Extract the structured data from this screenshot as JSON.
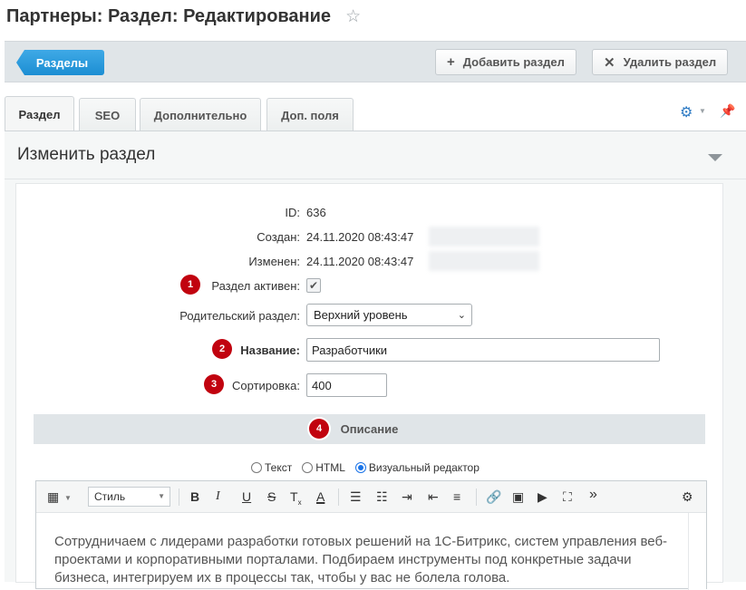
{
  "page": {
    "title": "Партнеры: Раздел: Редактирование"
  },
  "toolbar": {
    "back_label": "Разделы",
    "add_label": "Добавить раздел",
    "delete_label": "Удалить раздел"
  },
  "tabs": [
    {
      "label": "Раздел",
      "active": true
    },
    {
      "label": "SEO",
      "active": false
    },
    {
      "label": "Дополнительно",
      "active": false
    },
    {
      "label": "Доп. поля",
      "active": false
    }
  ],
  "panel": {
    "title": "Изменить раздел"
  },
  "form": {
    "id_label": "ID:",
    "id_value": "636",
    "created_label": "Создан:",
    "created_value": "24.11.2020 08:43:47",
    "modified_label": "Изменен:",
    "modified_value": "24.11.2020 08:43:47",
    "active_label": "Раздел активен:",
    "active_checked": true,
    "parent_label": "Родительский раздел:",
    "parent_value": "Верхний уровень",
    "name_label": "Название:",
    "name_value": "Разработчики",
    "sort_label": "Сортировка:",
    "sort_value": "400",
    "description_header": "Описание"
  },
  "badges": [
    "1",
    "2",
    "3",
    "4"
  ],
  "editor": {
    "modes": [
      "Текст",
      "HTML",
      "Визуальный редактор"
    ],
    "selected_mode": "Визуальный редактор",
    "style_label": "Стиль",
    "more_glyph": "»",
    "text": "Сотрудничаем с лидерами разработки готовых решений на 1С-Битрикс, систем управления веб-проектами и корпоративными порталами. Подбираем инструменты под конкретные задачи бизнеса, интегрируем их в процессы так, чтобы у вас не болела голова."
  },
  "colors": {
    "accent_blue": "#1c8ed3",
    "badge_red": "#c1030f",
    "band_gray": "#e0e5e8"
  },
  "icons": [
    "star-icon",
    "plus-icon",
    "close-icon",
    "gear-icon",
    "pin-icon",
    "collapse-arrow-icon",
    "checkmark-icon"
  ]
}
